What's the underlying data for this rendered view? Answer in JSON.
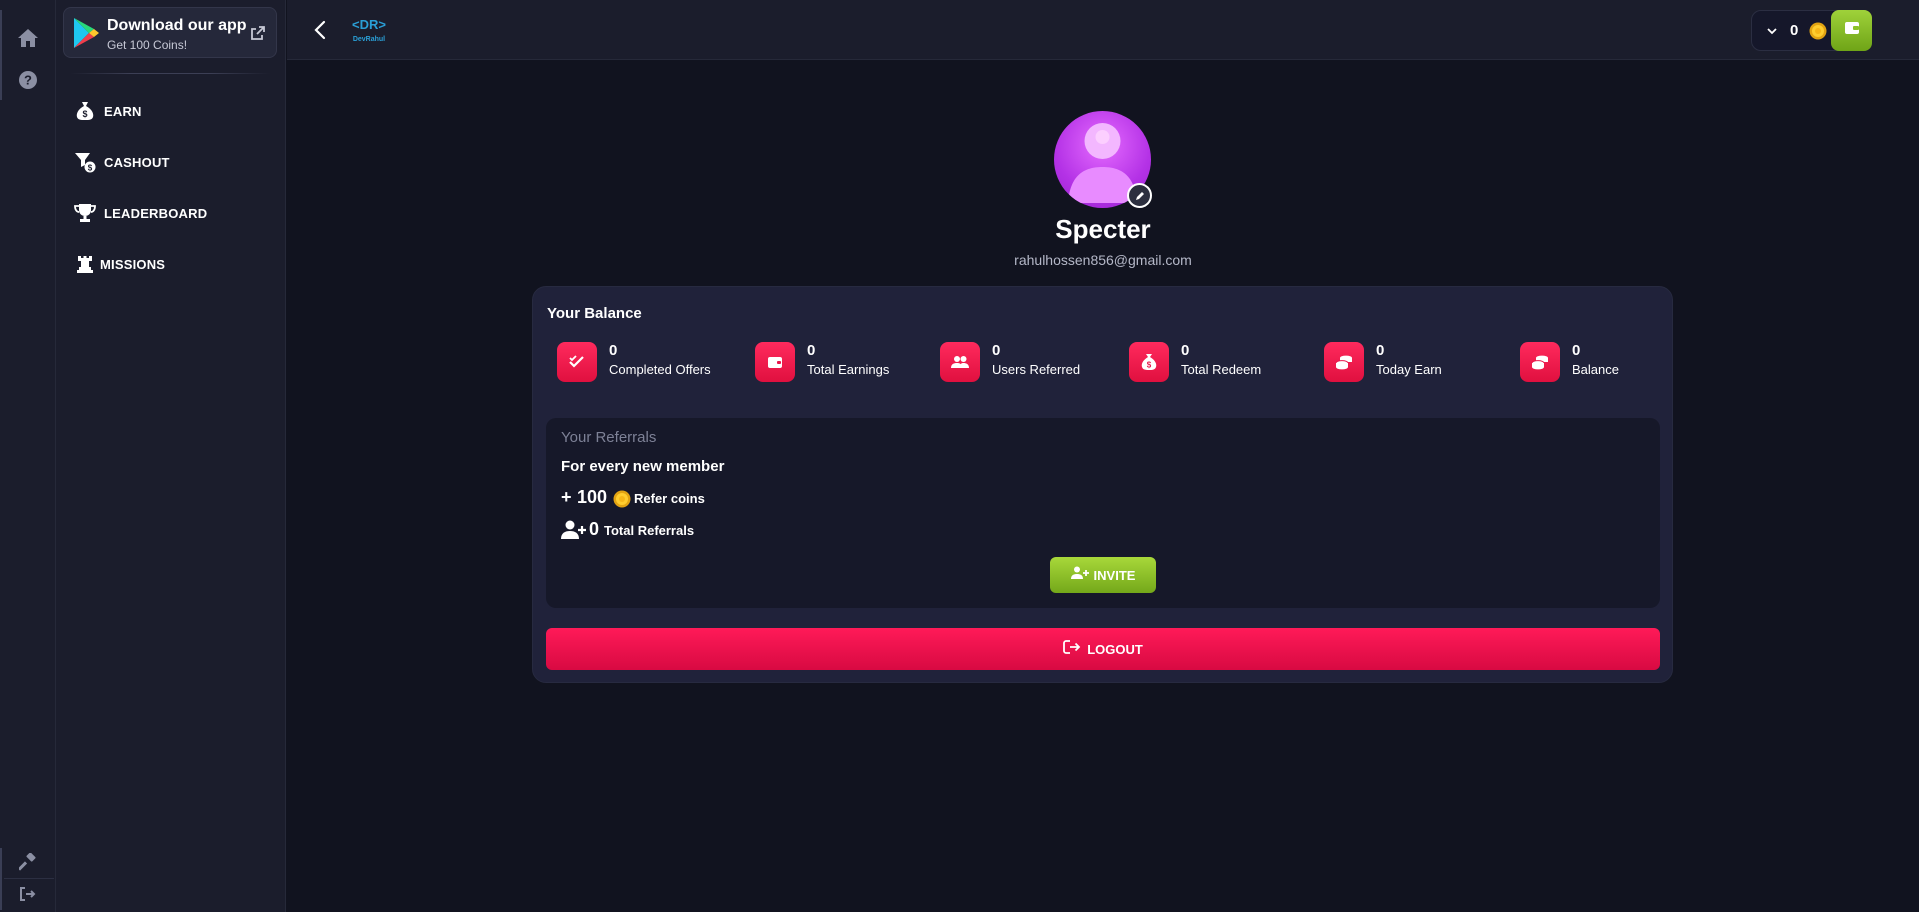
{
  "rail": {
    "items": [
      {
        "icon": "home-icon"
      },
      {
        "icon": "help-icon"
      }
    ],
    "bottom": [
      {
        "icon": "hammer-icon"
      },
      {
        "icon": "sign-out-icon"
      }
    ]
  },
  "sidebar": {
    "promo": {
      "title": "Download our app",
      "subtitle": "Get 100 Coins!"
    },
    "items": [
      {
        "label": "EARN",
        "icon": "money-bag-icon"
      },
      {
        "label": "CASHOUT",
        "icon": "cashout-icon"
      },
      {
        "label": "LEADERBOARD",
        "icon": "trophy-icon"
      },
      {
        "label": "MISSIONS",
        "icon": "rook-icon"
      }
    ]
  },
  "header": {
    "logo_text": "DevRahul",
    "wallet": {
      "coins": "0"
    }
  },
  "profile": {
    "name": "Specter",
    "email": "rahulhossen856@gmail.com"
  },
  "balance": {
    "title": "Your Balance",
    "stats": [
      {
        "value": "0",
        "label": "Completed Offers",
        "icon": "double-check-icon"
      },
      {
        "value": "0",
        "label": "Total Earnings",
        "icon": "wallet-icon"
      },
      {
        "value": "0",
        "label": "Users Referred",
        "icon": "users-icon"
      },
      {
        "value": "0",
        "label": "Total Redeem",
        "icon": "money-bag-icon"
      },
      {
        "value": "0",
        "label": "Today Earn",
        "icon": "coins-stack-icon"
      },
      {
        "value": "0",
        "label": "Balance",
        "icon": "coins-stack-icon"
      }
    ]
  },
  "referrals": {
    "heading": "Your Referrals",
    "subheading": "For every new member",
    "plus": "+",
    "amount": "100",
    "coins_label": "Refer coins",
    "total": "0",
    "total_label": "Total Referrals",
    "invite_label": "INVITE"
  },
  "logout_label": "LOGOUT",
  "colors": {
    "background": "#11131f",
    "panel": "#1b1d2c",
    "card": "#20223a",
    "accent_red": "#f0134d",
    "accent_green": "#8cc227",
    "avatar_purple": "#c13ef0"
  }
}
